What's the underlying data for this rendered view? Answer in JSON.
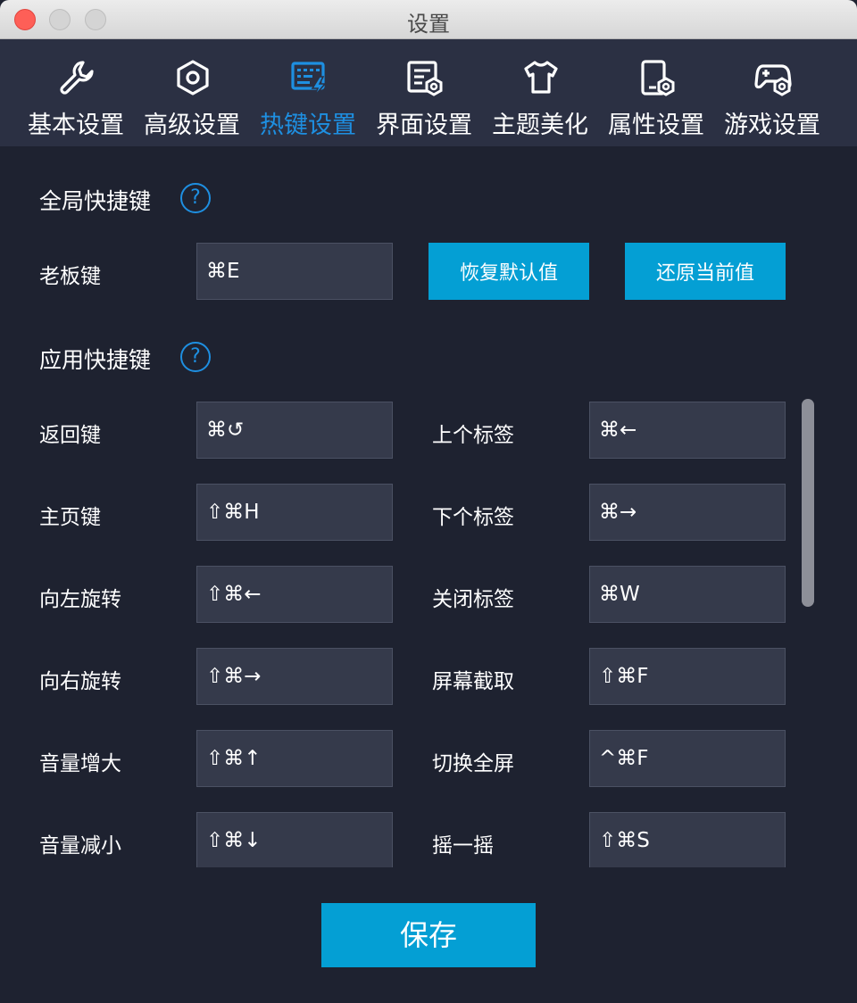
{
  "window": {
    "title": "设置"
  },
  "tabs": [
    {
      "label": "基本设置",
      "icon": "wrench-icon"
    },
    {
      "label": "高级设置",
      "icon": "hexagon-gear-icon"
    },
    {
      "label": "热键设置",
      "icon": "keyboard-lightning-icon",
      "active": true
    },
    {
      "label": "界面设置",
      "icon": "document-gear-icon"
    },
    {
      "label": "主题美化",
      "icon": "tshirt-icon"
    },
    {
      "label": "属性设置",
      "icon": "device-gear-icon"
    },
    {
      "label": "游戏设置",
      "icon": "gamepad-gear-icon"
    }
  ],
  "global": {
    "title": "全局快捷键",
    "help": "?",
    "boss_key_label": "老板键",
    "boss_key_value": "⌘E",
    "restore_default": "恢复默认值",
    "restore_current": "还原当前值"
  },
  "app": {
    "title": "应用快捷键",
    "help": "?",
    "left": [
      {
        "label": "返回键",
        "value": "⌘↺"
      },
      {
        "label": "主页键",
        "value": "⇧⌘H"
      },
      {
        "label": "向左旋转",
        "value": "⇧⌘←"
      },
      {
        "label": "向右旋转",
        "value": "⇧⌘→"
      },
      {
        "label": "音量增大",
        "value": "⇧⌘↑"
      },
      {
        "label": "音量减小",
        "value": "⇧⌘↓"
      }
    ],
    "right": [
      {
        "label": "上个标签",
        "value": "⌘←"
      },
      {
        "label": "下个标签",
        "value": "⌘→"
      },
      {
        "label": "关闭标签",
        "value": "⌘W"
      },
      {
        "label": "屏幕截取",
        "value": "⇧⌘F"
      },
      {
        "label": "切换全屏",
        "value": "^⌘F"
      },
      {
        "label": "摇一摇",
        "value": "⇧⌘S"
      }
    ]
  },
  "save_label": "保存",
  "colors": {
    "accent": "#1e8fe1",
    "button": "#049fd4",
    "background": "#1e2230",
    "tabbar": "#2b3043"
  }
}
